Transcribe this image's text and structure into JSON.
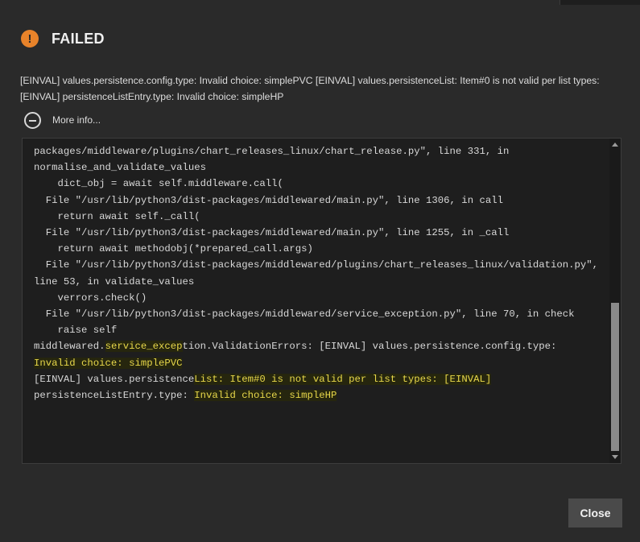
{
  "dialog": {
    "title": "FAILED",
    "error_message": "[EINVAL] values.persistence.config.type: Invalid choice: simplePVC [EINVAL] values.persistenceList: Item#0 is not valid per list types: [EINVAL] persistenceListEntry.type: Invalid choice: simpleHP",
    "more_info_label": "More info...",
    "close_label": "Close"
  },
  "traceback": {
    "lines": [
      "packages/middleware/plugins/chart_releases_linux/chart_release.py\", line 331, in",
      "normalise_and_validate_values",
      "    dict_obj = await self.middleware.call(",
      "  File \"/usr/lib/python3/dist-packages/middlewared/main.py\", line 1306, in call",
      "    return await self._call(",
      "  File \"/usr/lib/python3/dist-packages/middlewared/main.py\", line 1255, in _call",
      "    return await methodobj(*prepared_call.args)",
      "  File \"/usr/lib/python3/dist-packages/middlewared/plugins/chart_releases_linux/validation.py\",",
      "line 53, in validate_values",
      "    verrors.check()",
      "  File \"/usr/lib/python3/dist-packages/middlewared/service_exception.py\", line 70, in check",
      "    raise self"
    ],
    "line_exc_prefix": "middlewared.",
    "line_exc_highlight": "service_excep",
    "line_exc_suffix": "tion.ValidationErrors: [EINVAL] values.persistence.config.type:",
    "line_invalid_pvc": "Invalid choice: simplePVC",
    "line_list_prefix": "[EINVAL] values.persistence",
    "line_list_highlight": "List: Item#0 is not valid per list types: [EINVAL]",
    "line_entry_prefix": "persistenceListEntry.type: ",
    "line_entry_highlight": "Invalid choice: simpleHP"
  },
  "colors": {
    "warning": "#e8832a",
    "highlight": "#e8d84a"
  }
}
